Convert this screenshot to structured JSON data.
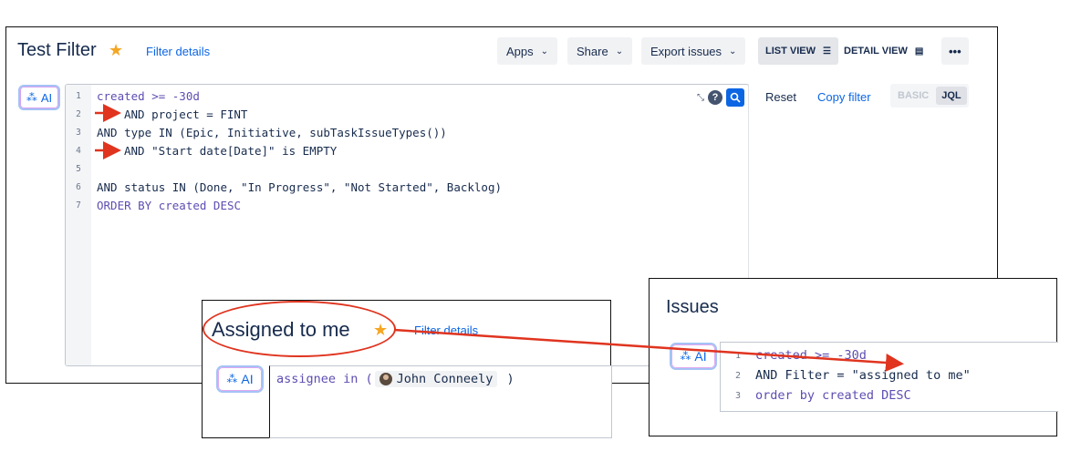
{
  "main": {
    "title": "Test Filter",
    "filter_details": "Filter details",
    "toolbar": {
      "apps": "Apps",
      "share": "Share",
      "export": "Export issues",
      "list_view": "LIST VIEW",
      "detail_view": "DETAIL VIEW",
      "more": "•••"
    },
    "ai_label": "AI",
    "code_lines": [
      {
        "n": "1",
        "text": "created >= -30d"
      },
      {
        "n": "2",
        "text": "AND project = FINT"
      },
      {
        "n": "3",
        "text": "AND type IN (Epic, Initiative, subTaskIssueTypes())"
      },
      {
        "n": "4",
        "text": "AND \"Start date[Date]\" is EMPTY"
      },
      {
        "n": "5",
        "text": ""
      },
      {
        "n": "6",
        "text": "AND status IN (Done, \"In Progress\", \"Not Started\", Backlog)"
      },
      {
        "n": "7",
        "text": "ORDER BY created DESC"
      }
    ],
    "reset": "Reset",
    "copy_filter": "Copy filter",
    "basic": "BASIC",
    "jql": "JQL"
  },
  "assigned": {
    "title": "Assigned to me",
    "filter_details": "Filter details",
    "ai_label": "AI",
    "query_prefix": "assignee in (",
    "user": "John Conneely",
    "query_suffix": " )"
  },
  "issues": {
    "title": "Issues",
    "ai_label": "AI",
    "code_lines": [
      {
        "n": "1",
        "text": "created >= -30d"
      },
      {
        "n": "2",
        "text": "AND Filter = \"assigned to me\""
      },
      {
        "n": "3",
        "text": "order by created DESC"
      }
    ]
  },
  "colors": {
    "accent": "#0c66e4",
    "annotation_red": "#e0341f",
    "star": "#f5a623"
  }
}
